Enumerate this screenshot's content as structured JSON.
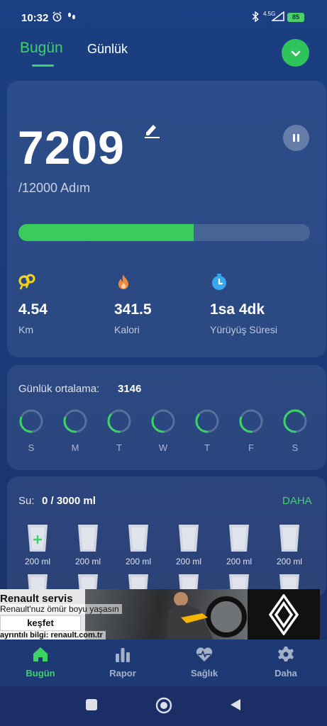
{
  "status_bar": {
    "time": "10:32",
    "network": "4.5G",
    "battery": "85"
  },
  "tabs": [
    {
      "label": "Bugün",
      "active": true
    },
    {
      "label": "Günlük",
      "active": false
    }
  ],
  "steps": {
    "value": "7209",
    "goal_text": "/12000 Adım",
    "progress_fraction": 0.6
  },
  "stats": [
    {
      "icon": "footprints-icon",
      "value": "4.54",
      "label": "Km",
      "color": "#f2d21b"
    },
    {
      "icon": "flame-icon",
      "value": "341.5",
      "label": "Kalori",
      "color": "#f28a3c"
    },
    {
      "icon": "stopwatch-icon",
      "value": "1sa 4dk",
      "label": "Yürüyüş Süresi",
      "color": "#3aa8f0"
    }
  ],
  "daily_average": {
    "label": "Günlük ortalama:",
    "value": "3146",
    "days": [
      {
        "letter": "S",
        "progress": 0.3
      },
      {
        "letter": "M",
        "progress": 0.3
      },
      {
        "letter": "T",
        "progress": 0.35
      },
      {
        "letter": "W",
        "progress": 0.3
      },
      {
        "letter": "T",
        "progress": 0.35
      },
      {
        "letter": "F",
        "progress": 0.3
      },
      {
        "letter": "S",
        "progress": 0.65
      }
    ]
  },
  "water": {
    "label": "Su:",
    "value": "0 / 3000 ml",
    "more": "DAHA",
    "cups": [
      {
        "label": "200 ml",
        "add": true
      },
      {
        "label": "200 ml",
        "add": false
      },
      {
        "label": "200 ml",
        "add": false
      },
      {
        "label": "200 ml",
        "add": false
      },
      {
        "label": "200 ml",
        "add": false
      },
      {
        "label": "200 ml",
        "add": false
      }
    ]
  },
  "ad": {
    "title": "Renault servis",
    "subtitle": "Renault'nuz ömür boyu yaşasın",
    "cta": "keşfet",
    "footer": "ayrıntılı bilgi: renault.com.tr"
  },
  "bottom_nav": [
    {
      "label": "Bugün",
      "icon": "home-icon",
      "active": true
    },
    {
      "label": "Rapor",
      "icon": "bar-chart-icon",
      "active": false
    },
    {
      "label": "Sağlık",
      "icon": "heart-pulse-icon",
      "active": false
    },
    {
      "label": "Daha",
      "icon": "gear-icon",
      "active": false
    }
  ],
  "colors": {
    "accent": "#3dd364",
    "background": "#1a3a78"
  }
}
